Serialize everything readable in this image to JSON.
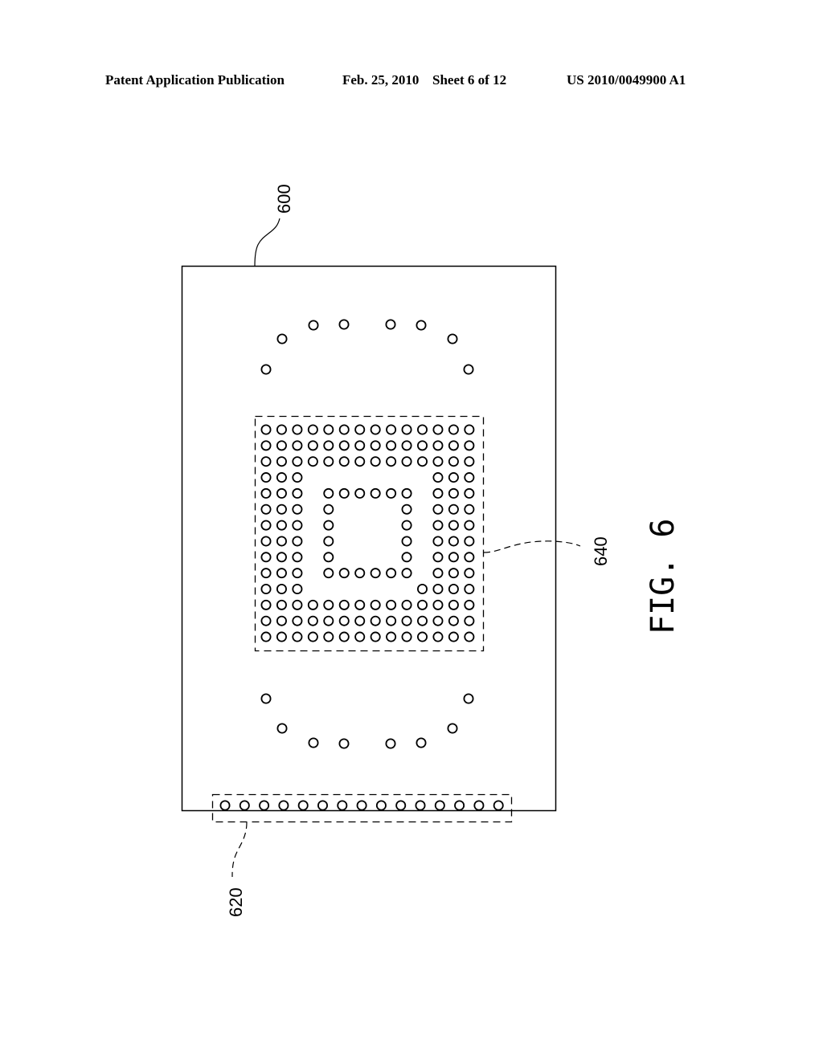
{
  "header": {
    "publication": "Patent Application Publication",
    "date": "Feb. 25, 2010",
    "sheet": "Sheet 6 of 12",
    "number": "US 2010/0049900 A1"
  },
  "figure": {
    "caption": "FIG. 6",
    "labels": {
      "board": "600",
      "connector": "620",
      "array": "640"
    },
    "array_grid": {
      "columns": 14,
      "rows": [
        [
          0,
          1,
          2,
          3,
          4,
          5,
          6,
          7,
          8,
          9,
          10,
          11,
          12,
          13
        ],
        [
          0,
          1,
          2,
          3,
          4,
          5,
          6,
          7,
          8,
          9,
          10,
          11,
          12,
          13
        ],
        [
          0,
          1,
          2,
          3,
          4,
          5,
          6,
          7,
          8,
          9,
          10,
          11,
          12,
          13
        ],
        [
          0,
          1,
          2,
          11,
          12,
          13
        ],
        [
          0,
          1,
          2,
          4,
          5,
          6,
          7,
          8,
          9,
          11,
          12,
          13
        ],
        [
          0,
          1,
          2,
          4,
          9,
          11,
          12,
          13
        ],
        [
          0,
          1,
          2,
          4,
          9,
          11,
          12,
          13
        ],
        [
          0,
          1,
          2,
          4,
          9,
          11,
          12,
          13
        ],
        [
          0,
          1,
          2,
          4,
          9,
          11,
          12,
          13
        ],
        [
          0,
          1,
          2,
          4,
          5,
          6,
          7,
          8,
          9,
          11,
          12,
          13
        ],
        [
          0,
          1,
          2,
          10,
          11,
          12,
          13
        ],
        [
          0,
          1,
          2,
          3,
          4,
          5,
          6,
          7,
          8,
          9,
          10,
          11,
          12,
          13
        ],
        [
          0,
          1,
          2,
          3,
          4,
          5,
          6,
          7,
          8,
          9,
          10,
          11,
          12,
          13
        ],
        [
          0,
          1,
          2,
          3,
          4,
          5,
          6,
          7,
          8,
          9,
          10,
          11,
          12,
          13
        ]
      ]
    },
    "upper_arc_count": 8,
    "lower_arc_count": 8,
    "connector_pin_count": 15
  }
}
